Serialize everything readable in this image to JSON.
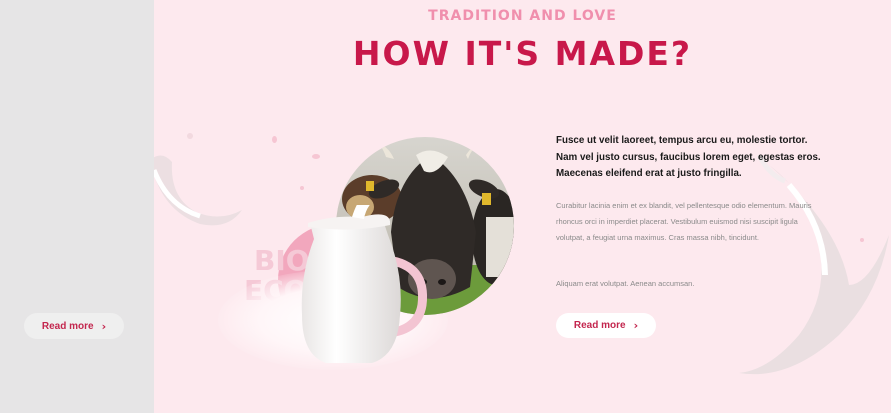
{
  "left_panel": {
    "read_more_label": "Read more",
    "chevron_icon": "chevron-right-icon"
  },
  "section": {
    "eyebrow": "TRADITION AND LOVE",
    "title": "HOW IT'S MADE?",
    "background_words": [
      "BIO",
      "ECO"
    ],
    "lead_text": "Fusce ut velit laoreet, tempus arcu eu, molestie tortor. Nam vel justo cursus, faucibus lorem eget, egestas eros. Maecenas eleifend erat at justo fringilla.",
    "body_text": "Curabitur lacinia enim et ex blandit, vel pellentesque odio elementum. Mauris rhoncus orci in imperdiet placerat. Vestibulum euismod nisi suscipit ligula volutpat, a feugiat urna maximus. Cras massa nibh, tincidunt.",
    "body_text_2": "Aliquam erat volutpat. Aenean accumsan.",
    "read_more_label": "Read more",
    "chevron_icon": "chevron-right-icon"
  },
  "colors": {
    "accent": "#c8184a",
    "eyebrow": "#f08fad",
    "section_bg": "#fde9ee",
    "side_bg": "#e6e5e6"
  },
  "images": {
    "cow": "cow-photo",
    "jug": "milk-jug",
    "splashes": [
      "milk-splash-left",
      "milk-splash-right"
    ]
  }
}
